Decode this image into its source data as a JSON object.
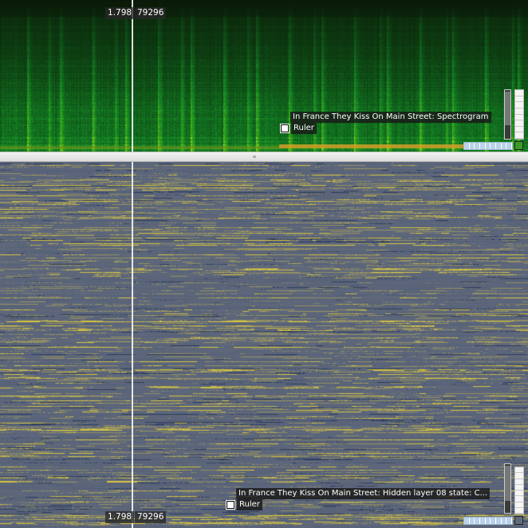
{
  "top_pane": {
    "ruler_value_left": "1.798",
    "ruler_value_right": "79296",
    "layer_name": "In France They Kiss On Main Street: Spectrogram",
    "ruler_label": "Ruler"
  },
  "bottom_pane": {
    "ruler_value_left": "1.798",
    "ruler_value_right": "79296",
    "layer_name": "In France They Kiss On Main Street: Hidden layer 08 state: C...",
    "ruler_label": "Ruler"
  },
  "colors": {
    "spectrogram_high": "#d9e23a",
    "spectrogram_mid": "#1f9a2e",
    "spectrogram_low": "#0a1a08",
    "heatmap_base": "#5f6a7d",
    "heatmap_high": "#d8c640",
    "heatmap_low": "#2d3b5c",
    "playhead": "#ffffff"
  },
  "icons": {
    "layer_swatch": "square-swatch-icon",
    "zoom_corner": "zoom-reset-icon"
  }
}
